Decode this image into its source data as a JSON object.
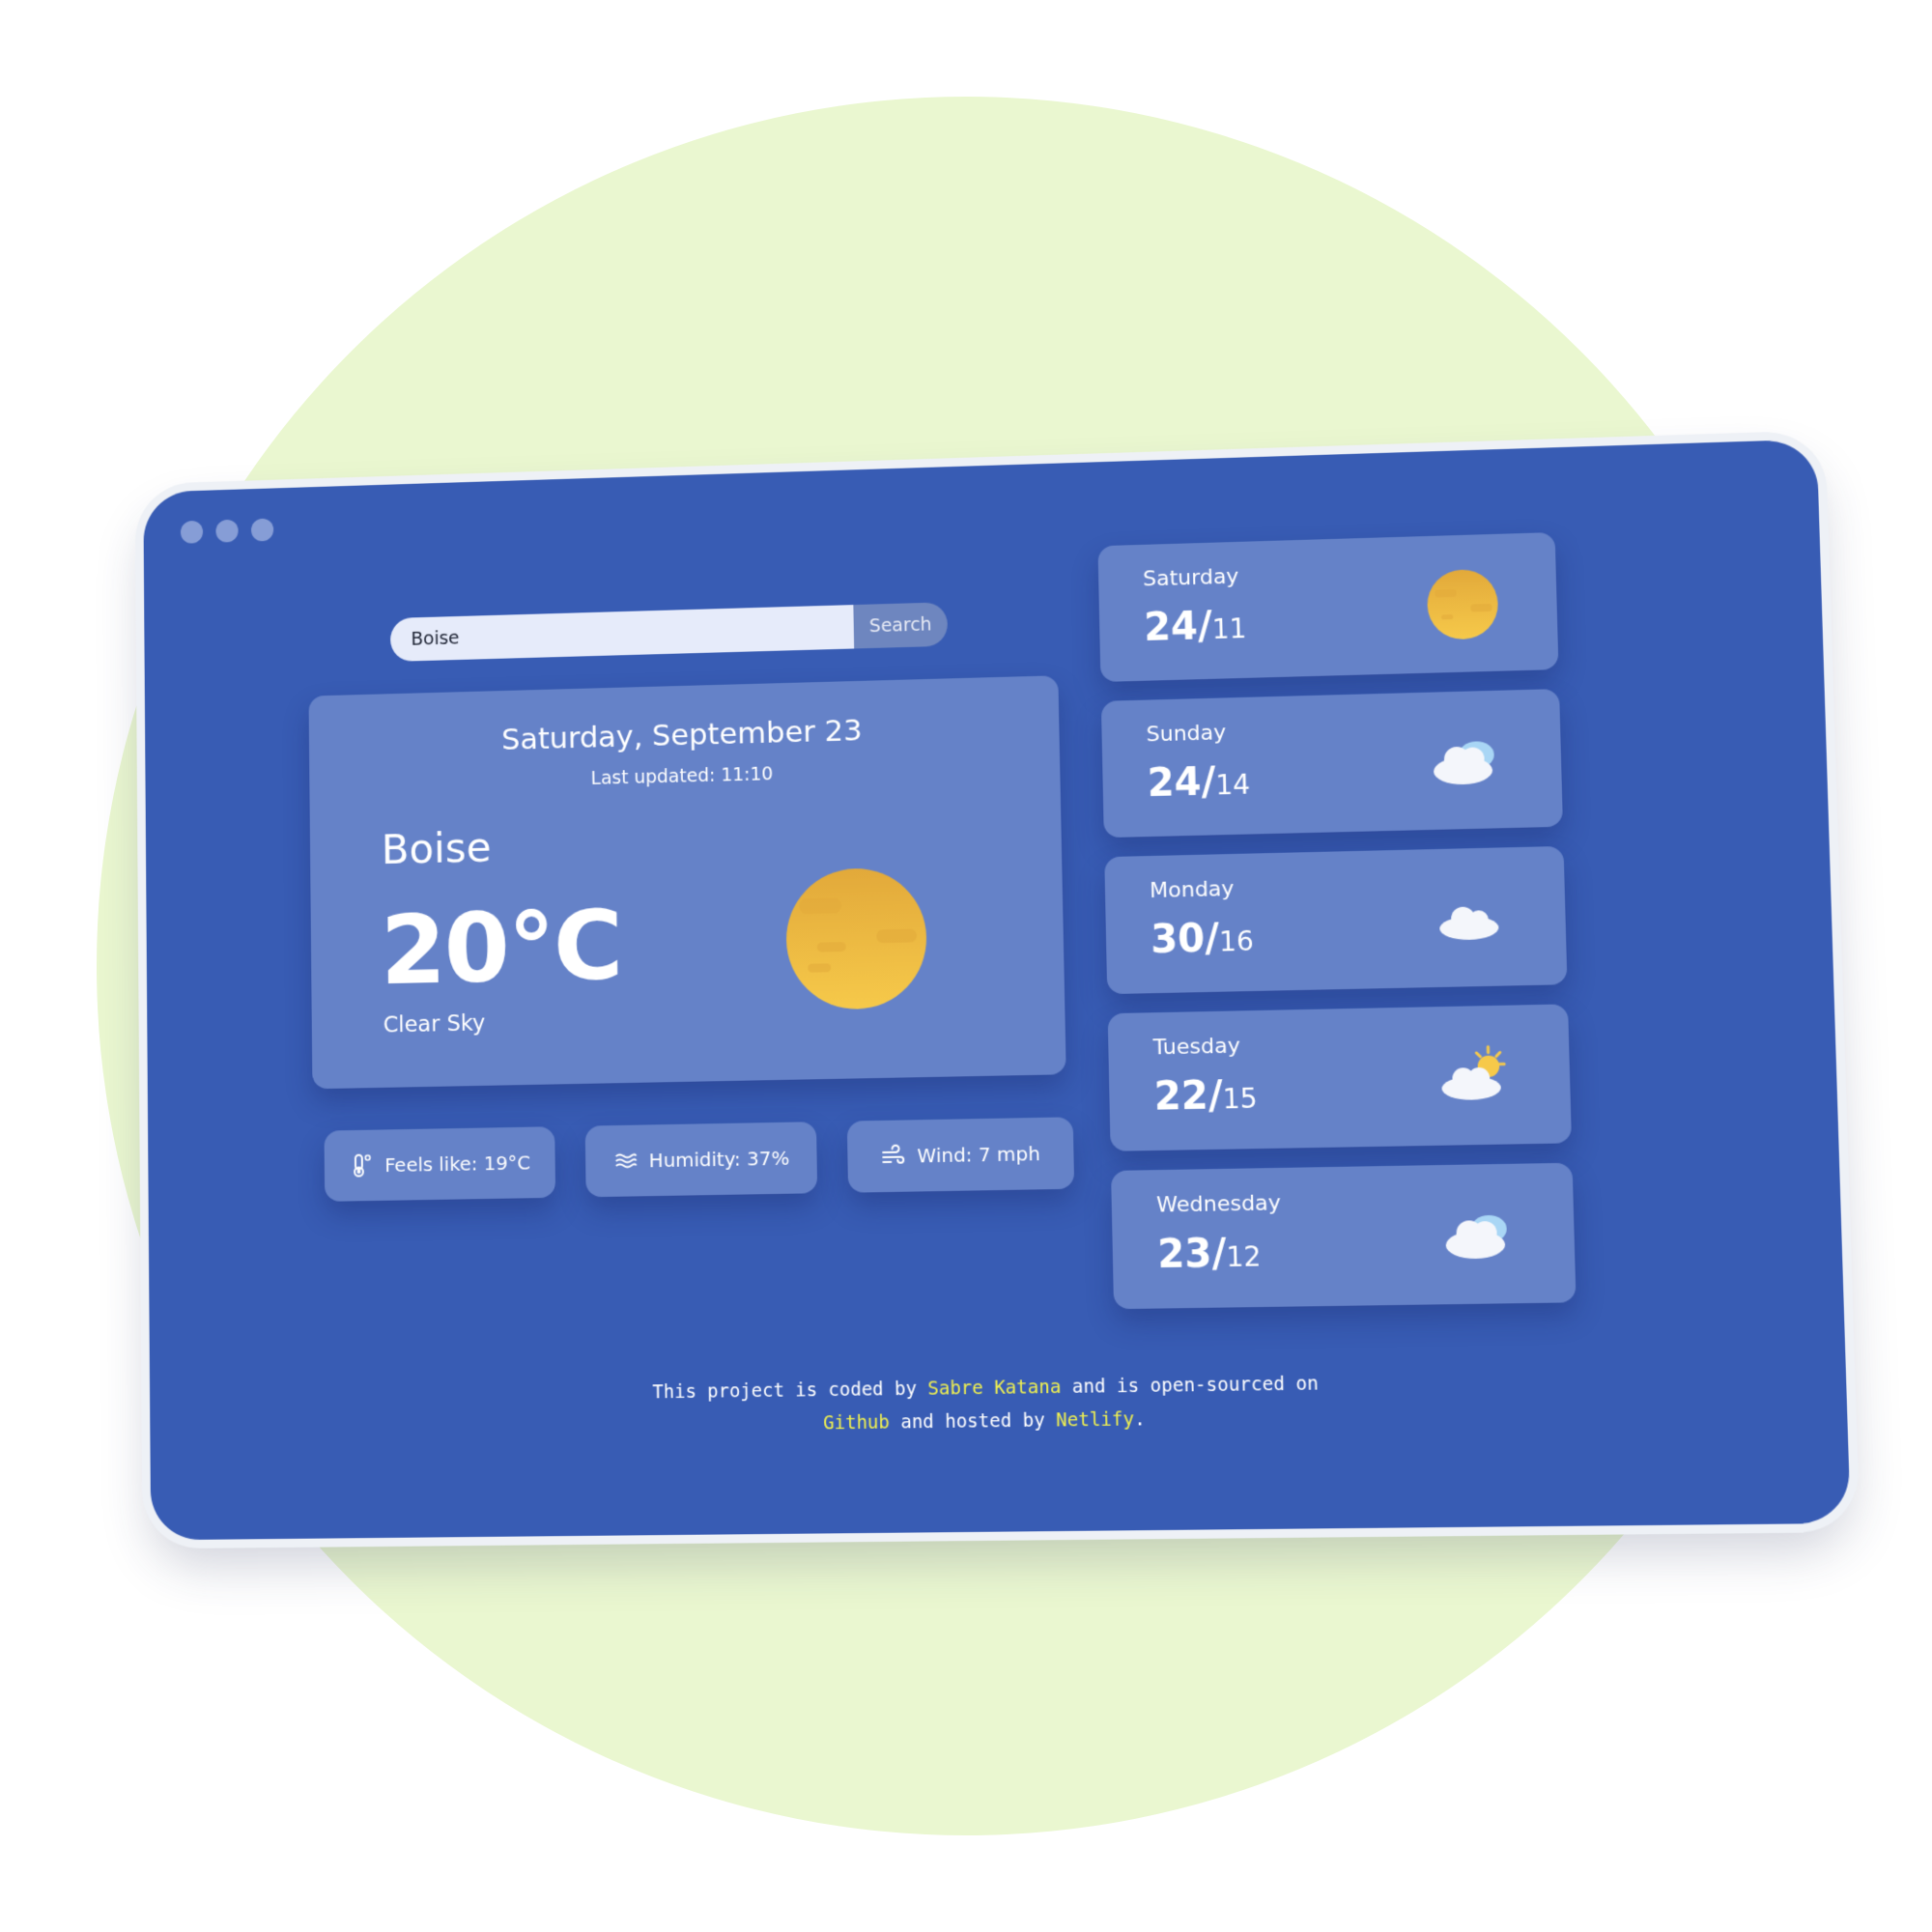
{
  "colors": {
    "page_background": "#ffffff",
    "blob": "#eaf7d0",
    "window_background": "#385cb4",
    "card_background": "#6582c8",
    "search_input_background": "#e6ebfa",
    "search_button_background": "#6e86bf",
    "link_highlight": "#f0f050",
    "sun_light": "#f6c94a",
    "sun_dark": "#e2a93a",
    "cloud": "#f4f6fb",
    "cloud_back": "#a9d6f5",
    "dot": "#c7d3f3"
  },
  "window": {
    "dots": [
      "dot",
      "dot",
      "dot"
    ]
  },
  "search": {
    "value": "Boise",
    "button_label": "Search"
  },
  "current": {
    "date": "Saturday, September 23",
    "updated": "Last updated: 11:10",
    "city": "Boise",
    "temperature": "20°C",
    "condition": "Clear Sky",
    "icon": "sun-icon"
  },
  "details": [
    {
      "icon": "thermometer-icon",
      "label": "Feels like: 19°C"
    },
    {
      "icon": "humidity-waves-icon",
      "label": "Humidity: 37%"
    },
    {
      "icon": "wind-icon",
      "label": "Wind: 7 mph"
    }
  ],
  "forecast": [
    {
      "day": "Saturday",
      "high": "24/",
      "low": "11",
      "icon": "sun-icon"
    },
    {
      "day": "Sunday",
      "high": "24/",
      "low": "14",
      "icon": "cloud-icon"
    },
    {
      "day": "Monday",
      "high": "30/",
      "low": "16",
      "icon": "cloud-icon"
    },
    {
      "day": "Tuesday",
      "high": "22/",
      "low": "15",
      "icon": "partly-cloudy-icon"
    },
    {
      "day": "Wednesday",
      "high": "23/",
      "low": "12",
      "icon": "cloud-icon"
    }
  ],
  "footer": {
    "line1_start": "This project is coded by ",
    "author": "Sabre Katana",
    "line1_end": " and is open-sourced on",
    "repo_link": "Github",
    "line2_mid": " and hosted by ",
    "host_link": "Netlify",
    "line2_end": "."
  }
}
